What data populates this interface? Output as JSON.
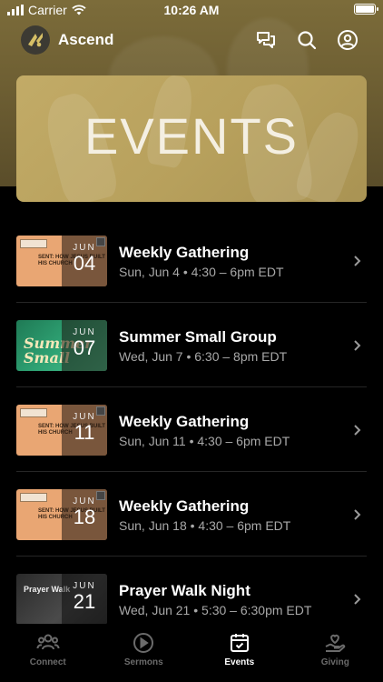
{
  "status_bar": {
    "carrier": "Carrier",
    "time": "10:26 AM"
  },
  "app_bar": {
    "title": "Ascend",
    "actions": [
      {
        "icon": "chat-bubbles-icon"
      },
      {
        "icon": "search-icon"
      },
      {
        "icon": "profile-icon"
      }
    ]
  },
  "banner": {
    "title": "EVENTS"
  },
  "events": [
    {
      "title": "Weekly Gathering",
      "meta": "Sun, Jun 4 • 4:30 – 6pm EDT",
      "month": "JUN",
      "day": "04",
      "art": "sent-how-jesus",
      "art_text": "SENT: HOW JESUS BUILT HIS CHURCH"
    },
    {
      "title": "Summer Small Group",
      "meta": "Wed, Jun 7 • 6:30 – 8pm EDT",
      "month": "JUN",
      "day": "07",
      "art": "summer-small",
      "art_text": "Summer Small"
    },
    {
      "title": "Weekly Gathering",
      "meta": "Sun, Jun 11 • 4:30 – 6pm EDT",
      "month": "JUN",
      "day": "11",
      "art": "sent-how-jesus",
      "art_text": "SENT: HOW JESUS BUILT HIS CHURCH"
    },
    {
      "title": "Weekly Gathering",
      "meta": "Sun, Jun 18 • 4:30 – 6pm EDT",
      "month": "JUN",
      "day": "18",
      "art": "sent-how-jesus",
      "art_text": "SENT: HOW JESUS BUILT HIS CHURCH"
    },
    {
      "title": "Prayer Walk Night",
      "meta": "Wed, Jun 21 • 5:30 – 6:30pm EDT",
      "month": "JUN",
      "day": "21",
      "art": "prayer-walk",
      "art_text": "Prayer Walk"
    }
  ],
  "tabs": [
    {
      "label": "Connect",
      "icon": "people-icon",
      "active": false
    },
    {
      "label": "Sermons",
      "icon": "play-circle-icon",
      "active": false
    },
    {
      "label": "Events",
      "icon": "calendar-icon",
      "active": true
    },
    {
      "label": "Giving",
      "icon": "heart-hand-icon",
      "active": false
    }
  ],
  "colors": {
    "header_gold": "#7c6c3a",
    "banner_gold": "#b7a05c",
    "sent_orange": "#e9a673",
    "summer_green": "#2fa374",
    "text_secondary": "#a8a8a8",
    "tab_inactive": "#6b6b6b"
  }
}
